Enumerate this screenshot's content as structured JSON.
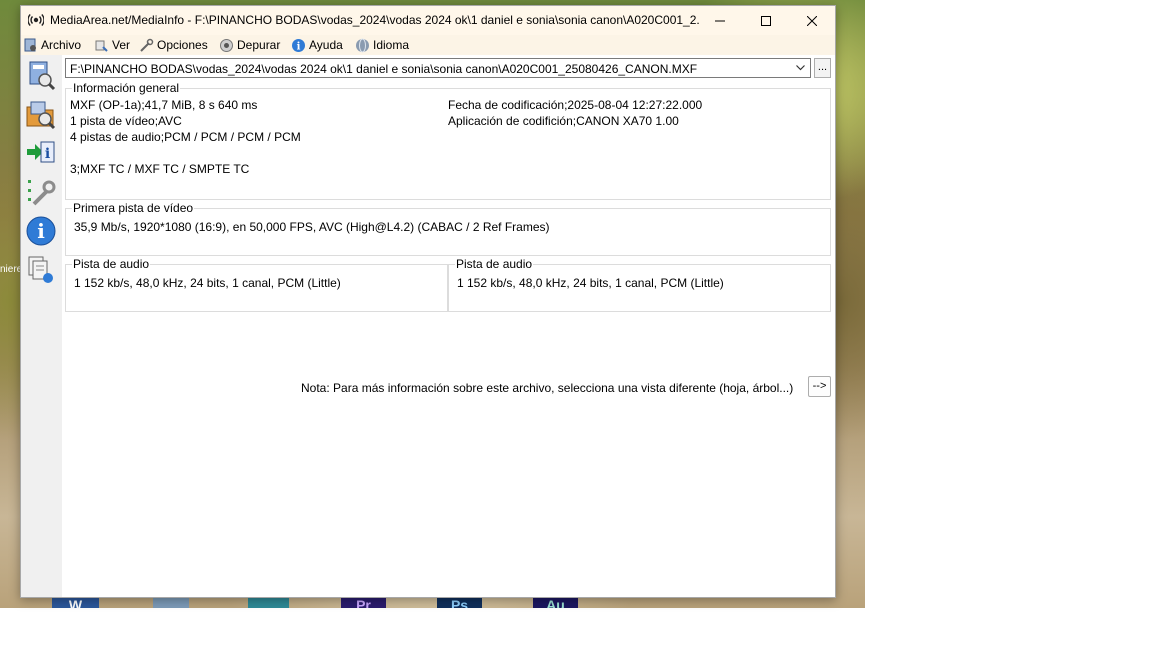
{
  "window": {
    "title": "MediaArea.net/MediaInfo - F:\\PINANCHO BODAS\\vodas_2024\\vodas 2024 ok\\1 daniel e sonia\\sonia canon\\A020C001_2...",
    "minimize_label": "Minimize",
    "maximize_label": "Maximize",
    "close_label": "Close"
  },
  "menu": [
    {
      "label": "Archivo",
      "icon": "file-icon"
    },
    {
      "label": "Ver",
      "icon": "view-icon"
    },
    {
      "label": "Opciones",
      "icon": "options-icon"
    },
    {
      "label": "Depurar",
      "icon": "debug-icon"
    },
    {
      "label": "Ayuda",
      "icon": "help-icon"
    },
    {
      "label": "Idioma",
      "icon": "language-icon"
    }
  ],
  "toolbar": [
    "open-file-icon",
    "open-folder-icon",
    "export-icon",
    "preferences-icon",
    "about-icon",
    "sheet-view-icon"
  ],
  "file_path": "F:\\PINANCHO BODAS\\vodas_2024\\vodas 2024 ok\\1 daniel e sonia\\sonia canon\\A020C001_25080426_CANON.MXF",
  "browse_label": "...",
  "general": {
    "title": "Información general",
    "left_lines": [
      "MXF (OP-1a);41,7 MiB, 8 s 640 ms",
      "1 pista de vídeo;AVC",
      "4 pistas de audio;PCM / PCM / PCM / PCM",
      "",
      "3;MXF TC / MXF TC / SMPTE TC"
    ],
    "right_lines": [
      "Fecha de codificación;2025-08-04 12:27:22.000",
      "Aplicación de codifición;CANON XA70 1.00"
    ]
  },
  "video": {
    "title": "Primera pista de vídeo",
    "line": "35,9 Mb/s, 1920*1080 (16:9), en 50,000 FPS, AVC (High@L4.2) (CABAC / 2 Ref Frames)"
  },
  "audio": [
    {
      "title": "Pista de audio",
      "line": "1 152 kb/s, 48,0 kHz, 24 bits, 1 canal, PCM (Little)"
    },
    {
      "title": "Pista de audio",
      "line": "1 152 kb/s, 48,0 kHz, 24 bits, 1 canal, PCM (Little)"
    }
  ],
  "note": "Nota: Para más información sobre este archivo, selecciona una vista diferente (hoja, árbol...)",
  "note_button": "-->",
  "desktop": {
    "stray_text": "niere",
    "taskbar": [
      {
        "label": "W",
        "icon": "word-icon",
        "color": "#2b579a"
      },
      {
        "label": "",
        "icon": "recycle-icon",
        "color": "#7c9bb8"
      },
      {
        "label": "",
        "icon": "app-icon",
        "color": "#2e8a96"
      },
      {
        "label": "Pr",
        "icon": "premiere-icon",
        "color": "#2a1b6e"
      },
      {
        "label": "Ps",
        "icon": "photoshop-icon",
        "color": "#0f2f5c"
      },
      {
        "label": "Au",
        "icon": "audition-icon",
        "color": "#1b1660"
      }
    ]
  }
}
